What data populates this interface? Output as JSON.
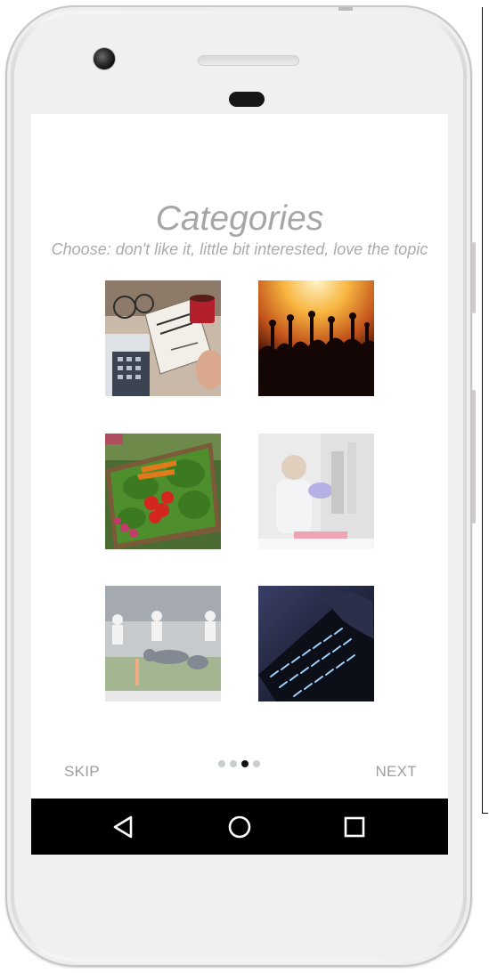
{
  "screen": {
    "title": "Categories",
    "subtitle": "Choose: don't like it, little bit interested, love the topic",
    "categories": [
      {
        "icon": "business-plan-image",
        "selected": true
      },
      {
        "icon": "concert-crowd-image",
        "selected": true
      },
      {
        "icon": "vegetables-image",
        "selected": true
      },
      {
        "icon": "science-lab-image",
        "selected": false
      },
      {
        "icon": "football-image",
        "selected": false
      },
      {
        "icon": "keyboard-image",
        "selected": true
      }
    ]
  },
  "footer": {
    "skip_label": "SKIP",
    "next_label": "NEXT",
    "page_count": 4,
    "active_page": 3
  },
  "navbar": {
    "back_icon": "back-triangle-icon",
    "home_icon": "home-circle-icon",
    "recents_icon": "recents-square-icon"
  }
}
